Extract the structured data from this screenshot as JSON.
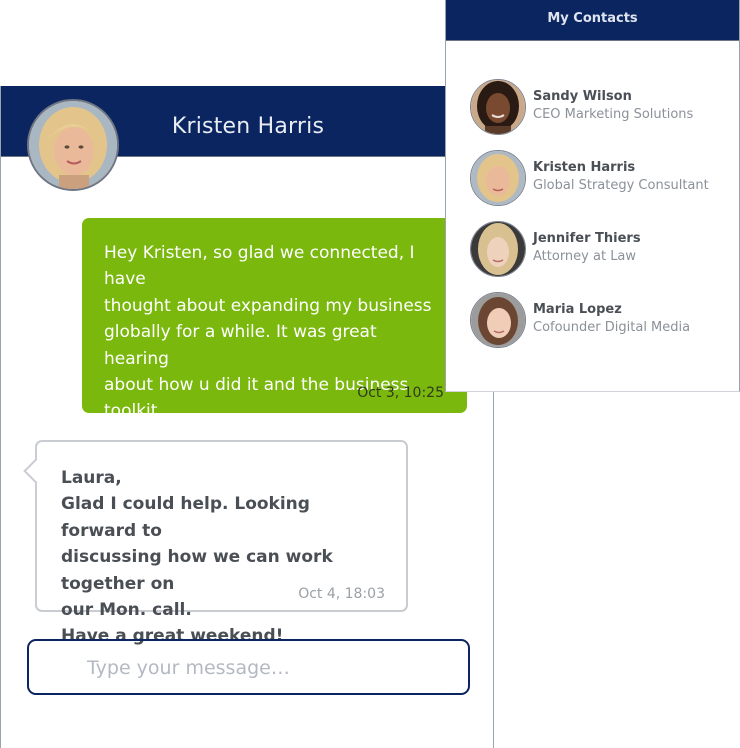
{
  "chat": {
    "contact_name": "Kristen Harris",
    "messages": [
      {
        "direction": "outgoing",
        "text": "Hey Kristen, so glad we connected, I have\nthought about expanding my business\nglobally for a while.  It was great hearing\nabout how u did it and the business toolkit\nwas amazing.  Looking forward to our next\ncall on Mon.",
        "time": "Oct  3, 10:25"
      },
      {
        "direction": "incoming",
        "text": "Laura,\nGlad I could help.  Looking forward to\ndiscussing how we can work together on\nour Mon. call.\nHave a great weekend!",
        "time": "Oct  4, 18:03"
      }
    ],
    "input": {
      "value": "",
      "placeholder": "Type your message…"
    }
  },
  "contacts": {
    "title": "My Contacts",
    "items": [
      {
        "name": "Sandy Wilson",
        "title": "CEO Marketing Solutions"
      },
      {
        "name": "Kristen Harris",
        "title": "Global Strategy Consultant"
      },
      {
        "name": "Jennifer Thiers",
        "title": "Attorney at Law"
      },
      {
        "name": "Maria Lopez",
        "title": "Cofounder Digital Media"
      }
    ]
  },
  "colors": {
    "header_navy": "#0b2560",
    "outgoing_bubble": "#7ab80e",
    "incoming_border": "#c9ccd0"
  }
}
